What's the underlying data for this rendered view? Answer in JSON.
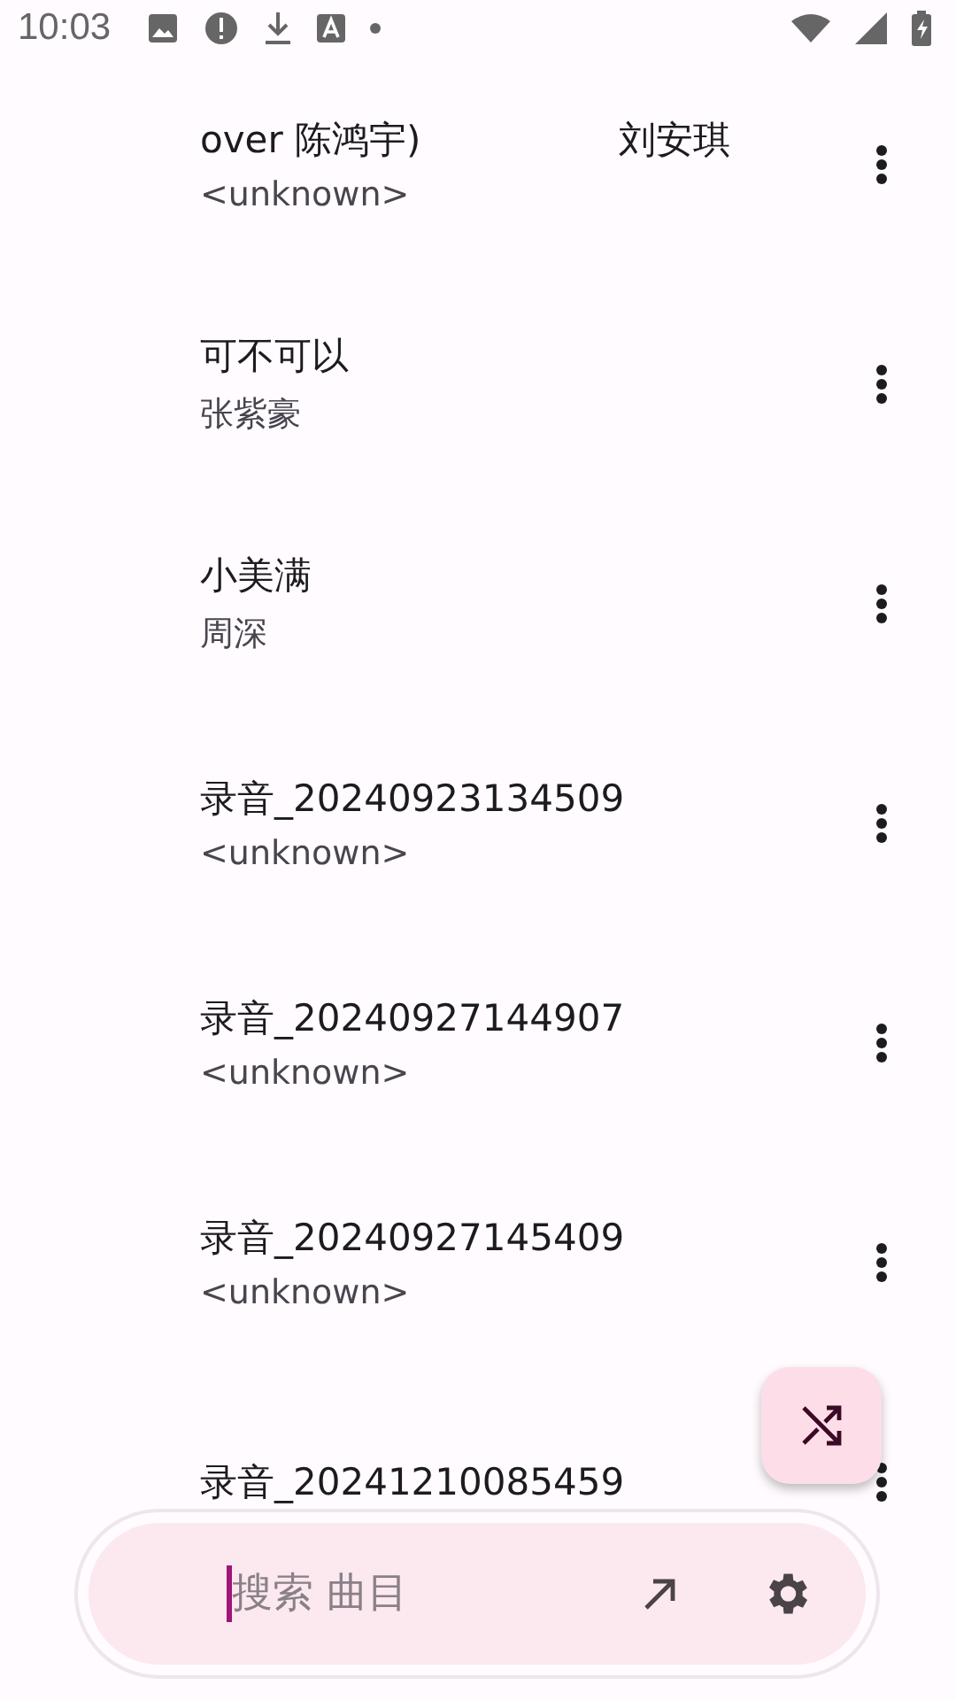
{
  "status_bar": {
    "time": "10:03"
  },
  "songs": [
    {
      "title": "over 陈鸿宇)",
      "title_tail": "刘安琪",
      "artist": "<unknown>"
    },
    {
      "title": "可不可以",
      "artist": "张紫豪"
    },
    {
      "title": "小美满",
      "artist": "周深"
    },
    {
      "title": "录音_20240923134509",
      "artist": "<unknown>"
    },
    {
      "title": "录音_20240927144907",
      "artist": "<unknown>"
    },
    {
      "title": "录音_20240927145409",
      "artist": "<unknown>"
    },
    {
      "title": "录音_20241210085459"
    }
  ],
  "search": {
    "placeholder": "搜索 曲目"
  }
}
